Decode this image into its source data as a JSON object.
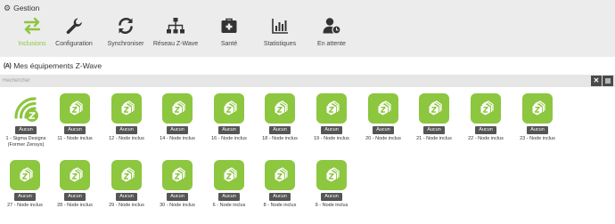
{
  "gestion": {
    "title": "Gestion",
    "icon": "gear-icon"
  },
  "toolbar": {
    "items": [
      {
        "label": "Inclusions",
        "icon": "swap-arrows-icon",
        "active": true
      },
      {
        "label": "Configuration",
        "icon": "wrench-icon",
        "active": false
      },
      {
        "label": "Synchroniser",
        "icon": "sync-icon",
        "active": false
      },
      {
        "label": "Réseau Z-Wave",
        "icon": "network-icon",
        "active": false
      },
      {
        "label": "Santé",
        "icon": "medkit-icon",
        "active": false
      },
      {
        "label": "Statistiques",
        "icon": "bar-chart-icon",
        "active": false
      },
      {
        "label": "En attente",
        "icon": "user-clock-icon",
        "active": false
      }
    ]
  },
  "section": {
    "title": "Mes équipements Z-Wave",
    "icon_text": "(A)"
  },
  "search": {
    "placeholder": "Rechercher",
    "clear_icon": "close-icon",
    "settings_icon": "bars-icon"
  },
  "devices": [
    {
      "badge": "Aucun",
      "name": "1 - Sigma Designs (Former Zensys)",
      "name_lines": [
        "1 - Sigma Designs",
        "(Former Zensys)"
      ],
      "icon": "zwave-controller-icon"
    },
    {
      "badge": "Aucun",
      "name": "11 - Node inclus",
      "name_lines": [
        "11 - Node inclus"
      ],
      "icon": "zwave-node-icon"
    },
    {
      "badge": "Aucun",
      "name": "12 - Node inclus",
      "name_lines": [
        "12 - Node inclus"
      ],
      "icon": "zwave-node-icon"
    },
    {
      "badge": "Aucun",
      "name": "14 - Node inclus",
      "name_lines": [
        "14 - Node inclus"
      ],
      "icon": "zwave-node-icon"
    },
    {
      "badge": "Aucun",
      "name": "16 - Node inclus",
      "name_lines": [
        "16 - Node inclus"
      ],
      "icon": "zwave-node-icon"
    },
    {
      "badge": "Aucun",
      "name": "18 - Node inclus",
      "name_lines": [
        "18 - Node inclus"
      ],
      "icon": "zwave-node-icon"
    },
    {
      "badge": "Aucun",
      "name": "19 - Node inclus",
      "name_lines": [
        "19 - Node inclus"
      ],
      "icon": "zwave-node-icon"
    },
    {
      "badge": "Aucun",
      "name": "20 - Node inclus",
      "name_lines": [
        "20 - Node inclus"
      ],
      "icon": "zwave-node-icon"
    },
    {
      "badge": "Aucun",
      "name": "21 - Node inclus",
      "name_lines": [
        "21 - Node inclus"
      ],
      "icon": "zwave-node-icon"
    },
    {
      "badge": "Aucun",
      "name": "22 - Node inclus",
      "name_lines": [
        "22 - Node inclus"
      ],
      "icon": "zwave-node-icon"
    },
    {
      "badge": "Aucun",
      "name": "23 - Node inclus",
      "name_lines": [
        "23 - Node inclus"
      ],
      "icon": "zwave-node-icon"
    },
    {
      "badge": "Aucun",
      "name": "27 - Node inclus",
      "name_lines": [
        "27 - Node inclus"
      ],
      "icon": "zwave-node-icon"
    },
    {
      "badge": "Aucun",
      "name": "28 - Node inclus",
      "name_lines": [
        "28 - Node inclus"
      ],
      "icon": "zwave-node-icon"
    },
    {
      "badge": "Aucun",
      "name": "29 - Node inclus",
      "name_lines": [
        "29 - Node inclus"
      ],
      "icon": "zwave-node-icon"
    },
    {
      "badge": "Aucun",
      "name": "30 - Node inclus",
      "name_lines": [
        "30 - Node inclus"
      ],
      "icon": "zwave-node-icon"
    },
    {
      "badge": "Aucun",
      "name": "6 - Node inclus",
      "name_lines": [
        "6 - Node inclus"
      ],
      "icon": "zwave-node-icon"
    },
    {
      "badge": "Aucun",
      "name": "8 - Node inclus",
      "name_lines": [
        "8 - Node inclus"
      ],
      "icon": "zwave-node-icon"
    },
    {
      "badge": "Aucun",
      "name": "9 - Node inclus",
      "name_lines": [
        "9 - Node inclus"
      ],
      "icon": "zwave-node-icon"
    }
  ],
  "colors": {
    "accent": "#8dc63f",
    "panel": "#ececec",
    "badge": "#555555",
    "search_bar": "#e6e6e6"
  }
}
